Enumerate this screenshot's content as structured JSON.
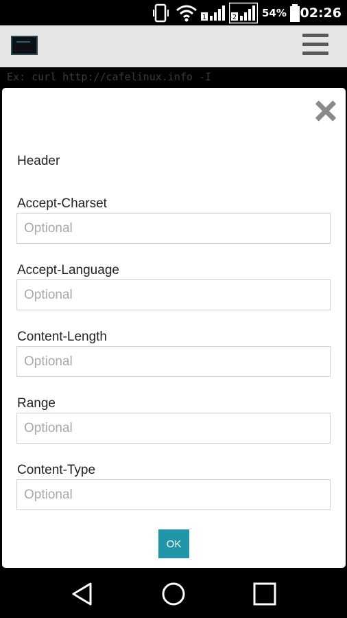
{
  "status_bar": {
    "battery_percent": "54%",
    "time": "02:26",
    "icons": [
      "vibrate-icon",
      "wifi-icon",
      "signal-1-icon",
      "signal-2-icon",
      "battery-icon"
    ]
  },
  "app_bar": {
    "logo": "terminal-logo",
    "menu_icon": "hamburger-menu-icon"
  },
  "terminal": {
    "placeholder_text": "Ex: curl http://cafelinux.info -I"
  },
  "modal": {
    "title": "Header",
    "close_icon": "close-icon",
    "fields": [
      {
        "label": "Accept-Charset",
        "placeholder": "Optional",
        "value": ""
      },
      {
        "label": "Accept-Language",
        "placeholder": "Optional",
        "value": ""
      },
      {
        "label": "Content-Length",
        "placeholder": "Optional",
        "value": ""
      },
      {
        "label": "Range",
        "placeholder": "Optional",
        "value": ""
      },
      {
        "label": "Content-Type",
        "placeholder": "Optional",
        "value": ""
      }
    ],
    "ok_label": "OK"
  },
  "nav_bar": {
    "back": "back-icon",
    "home": "home-icon",
    "recents": "recents-icon"
  },
  "colors": {
    "accent": "#2196a8",
    "app_bar_bg": "#e6e6e6"
  }
}
